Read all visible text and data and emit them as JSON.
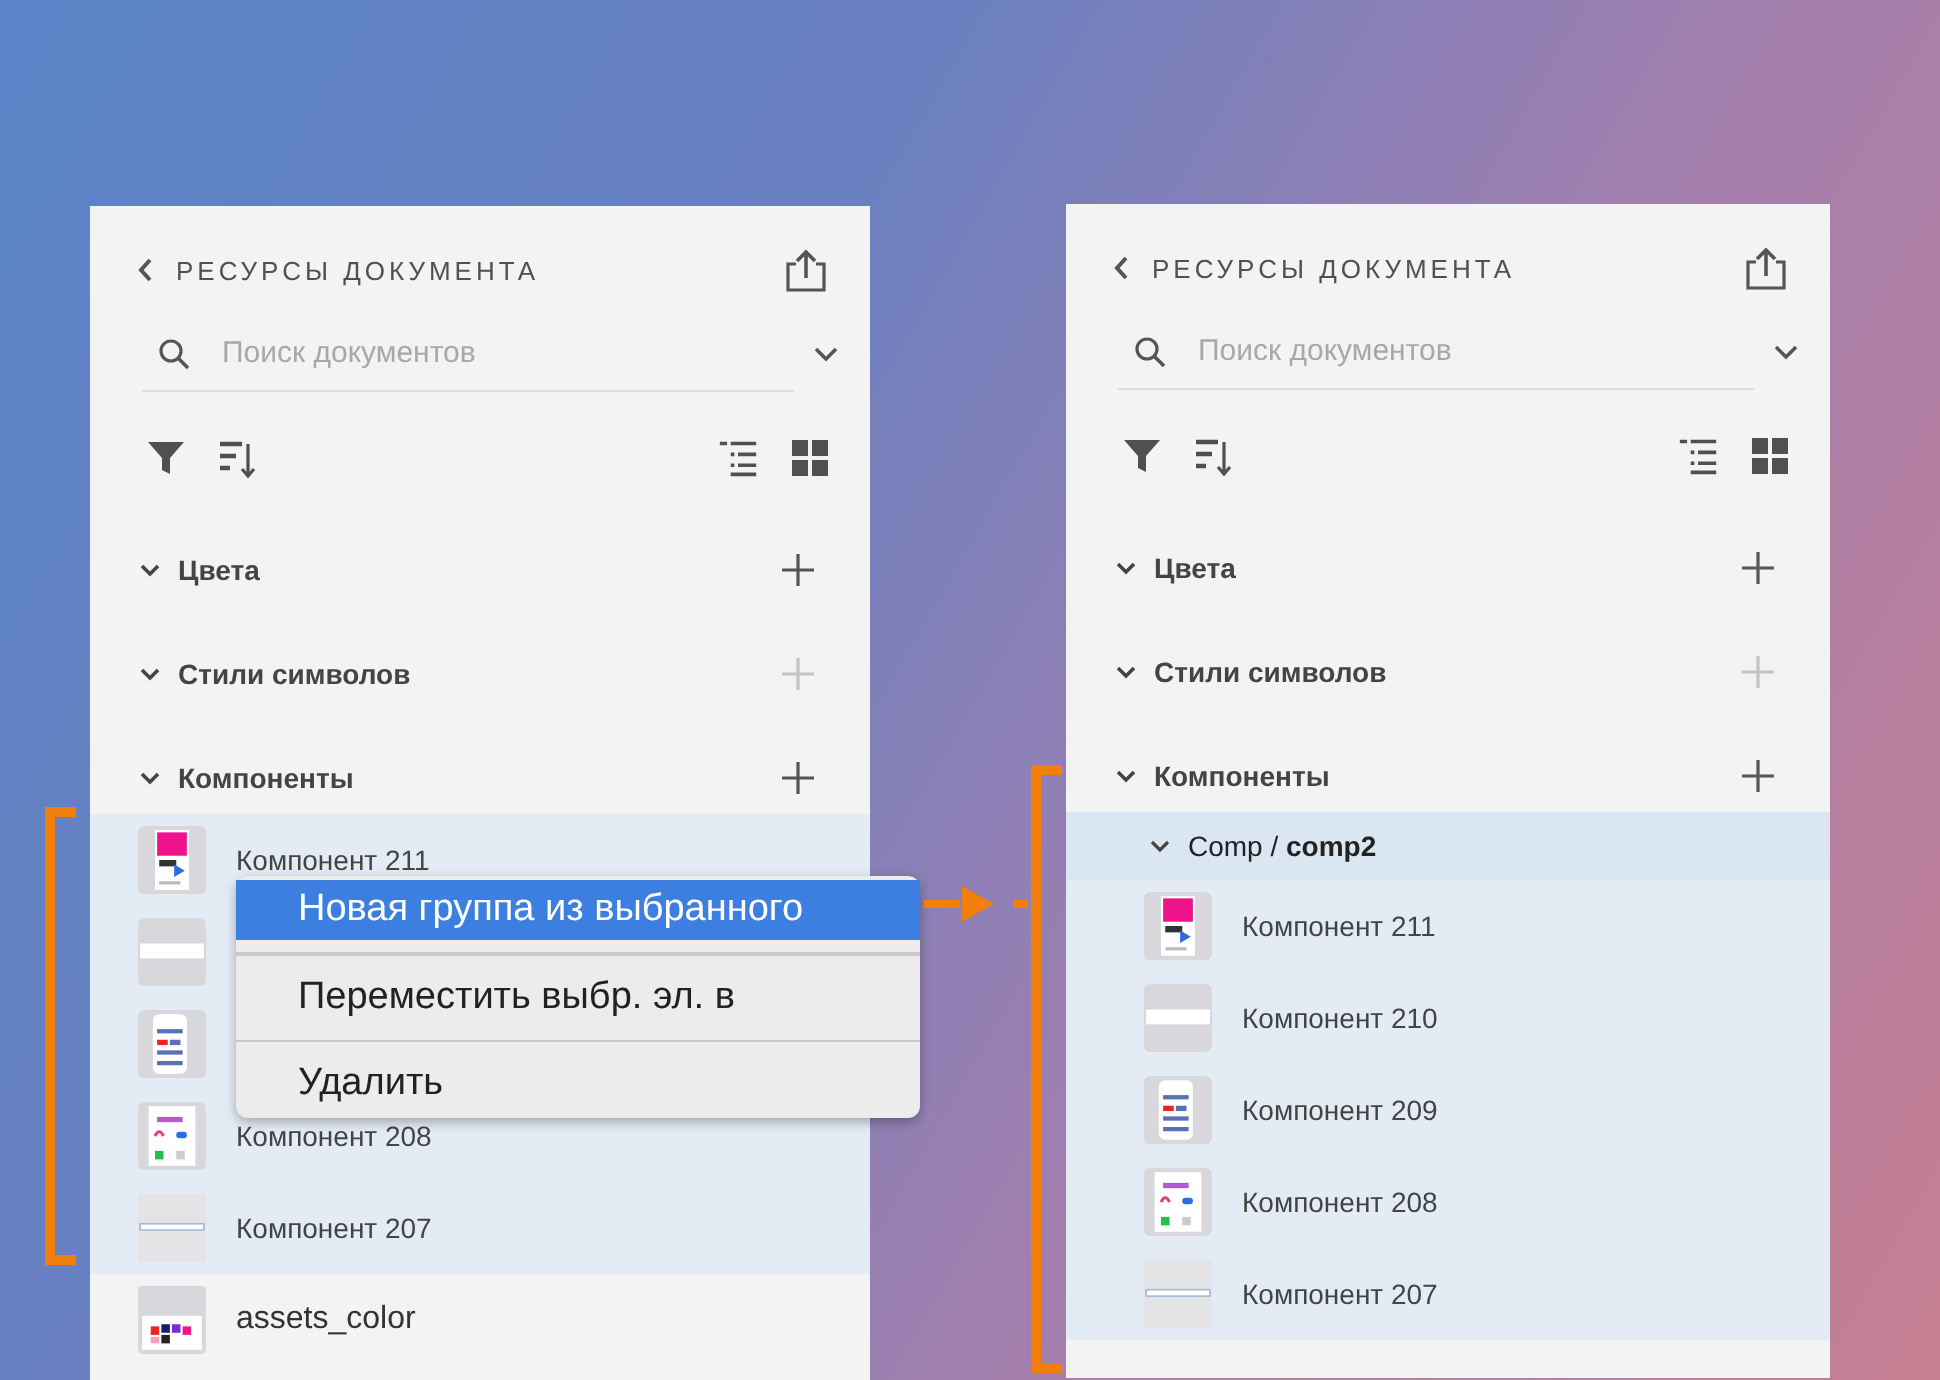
{
  "panels": [
    {
      "title": "РЕСУРСЫ ДОКУМЕНТА",
      "search": {
        "placeholder": "Поиск документов"
      },
      "sections": [
        {
          "label": "Цвета",
          "expanded": true,
          "add_enabled": true
        },
        {
          "label": "Стили символов",
          "expanded": true,
          "add_enabled": false
        },
        {
          "label": "Компоненты",
          "expanded": true,
          "add_enabled": true
        }
      ],
      "items": [
        {
          "label": "Компонент 211",
          "kind": "gradient",
          "selected": true
        },
        {
          "kind": "bar",
          "selected": true
        },
        {
          "kind": "list",
          "selected": true
        },
        {
          "label": "Компонент 208",
          "kind": "palette",
          "selected": true
        },
        {
          "label": "Компонент 207",
          "kind": "line",
          "selected": true
        },
        {
          "label": "assets_color",
          "kind": "swatches",
          "selected": false
        }
      ],
      "context_menu": {
        "items": [
          {
            "label": "Новая группа из выбранного",
            "selected": true
          },
          {
            "label": "Переместить выбр. эл. в",
            "selected": false
          },
          {
            "label": "Удалить",
            "selected": false
          }
        ]
      }
    },
    {
      "title": "РЕСУРСЫ ДОКУМЕНТА",
      "search": {
        "placeholder": "Поиск документов"
      },
      "sections": [
        {
          "label": "Цвета",
          "expanded": true,
          "add_enabled": true
        },
        {
          "label": "Стили символов",
          "expanded": true,
          "add_enabled": false
        },
        {
          "label": "Компоненты",
          "expanded": true,
          "add_enabled": true
        }
      ],
      "group": {
        "label": "Comp / **comp2**",
        "expanded": true
      },
      "items": [
        {
          "label": "Компонент 211",
          "kind": "gradient",
          "selected": true
        },
        {
          "label": "Компонент 210",
          "kind": "bar",
          "selected": true
        },
        {
          "label": "Компонент 209",
          "kind": "list",
          "selected": true
        },
        {
          "label": "Компонент 208",
          "kind": "palette",
          "selected": true
        },
        {
          "label": "Компонент 207",
          "kind": "line",
          "selected": true
        }
      ]
    }
  ]
}
